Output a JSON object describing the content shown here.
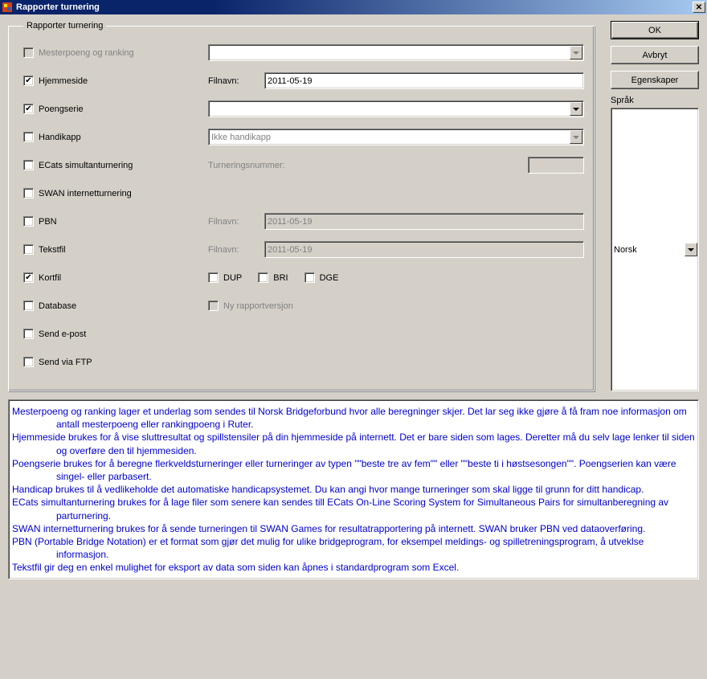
{
  "window": {
    "title": "Rapporter turnering"
  },
  "group": {
    "legend": "Rapporter turnering"
  },
  "items": {
    "mesterpoeng": {
      "label": "Mesterpoeng og ranking",
      "checked": false
    },
    "hjemmeside": {
      "label": "Hjemmeside",
      "checked": true,
      "filnavn_label": "Filnavn:",
      "filnavn_value": "2011-05-19"
    },
    "poengserie": {
      "label": "Poengserie",
      "checked": true,
      "select_value": ""
    },
    "handikapp": {
      "label": "Handikapp",
      "checked": false,
      "select_value": "Ikke handikapp"
    },
    "ecats": {
      "label": "ECats simultanturnering",
      "checked": false,
      "num_label": "Turneringsnummer:",
      "num_value": ""
    },
    "swan": {
      "label": "SWAN internetturnering",
      "checked": false
    },
    "pbn": {
      "label": "PBN",
      "checked": false,
      "filnavn_label": "Filnavn:",
      "filnavn_value": "2011-05-19"
    },
    "tekstfil": {
      "label": "Tekstfil",
      "checked": false,
      "filnavn_label": "Filnavn:",
      "filnavn_value": "2011-05-19"
    },
    "kortfil": {
      "label": "Kortfil",
      "checked": true,
      "dup": "DUP",
      "bri": "BRI",
      "dge": "DGE"
    },
    "database": {
      "label": "Database",
      "checked": false,
      "ny_label": "Ny rapportversjon"
    },
    "sendepost": {
      "label": "Send e-post",
      "checked": false
    },
    "sendftp": {
      "label": "Send via FTP",
      "checked": false
    }
  },
  "buttons": {
    "ok": "OK",
    "avbryt": "Avbryt",
    "egenskaper": "Egenskaper"
  },
  "language": {
    "label": "Språk",
    "value": "Norsk"
  },
  "help": {
    "p1": "Mesterpoeng og ranking lager et underlag som sendes til Norsk Bridgeforbund hvor alle beregninger skjer. Det lar seg ikke gjøre å få fram noe informasjon om antall mesterpoeng eller rankingpoeng i Ruter.",
    "p2": "Hjemmeside brukes for å vise sluttresultat og spillstensiler på din hjemmeside på internett. Det er bare siden som lages. Deretter må du selv lage lenker til siden og overføre den til hjemmesiden.",
    "p3": "Poengserie brukes for å beregne flerkveldsturneringer eller turneringer av typen \"\"beste tre av fem\"\" eller \"\"beste ti i høstsesongen\"\". Poengserien kan være singel- eller parbasert.",
    "p4": "Handicap brukes til å vedlikeholde det automatiske handicapsystemet. Du kan angi hvor mange turneringer som skal ligge til grunn for ditt handicap.",
    "p5": "ECats simultanturnering brukes for å lage filer som senere kan sendes till ECats On-Line Scoring System for Simultaneous Pairs for simultanberegning av parturnering.",
    "p6": "SWAN internetturnering brukes for å sende turneringen til SWAN Games for resultatrapportering på internett. SWAN bruker PBN ved dataoverføring.",
    "p7": "PBN (Portable Bridge Notation) er et format som gjør det mulig for ulike bridgeprogram, for eksempel meldings- og spilletreningsprogram, å utveklse informasjon.",
    "p8": "Tekstfil gir deg en enkel mulighet for eksport av data som siden kan åpnes i standardprogram som Excel."
  }
}
